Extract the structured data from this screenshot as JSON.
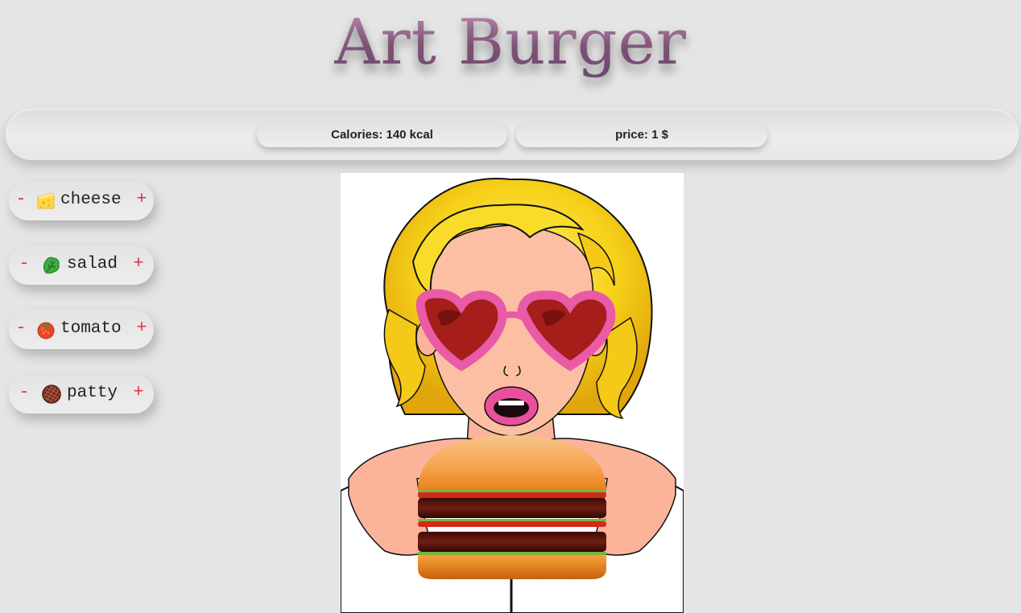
{
  "app": {
    "title": "Art Burger"
  },
  "stats": {
    "calories": "Calories: 140 kcal",
    "price": "price: 1 $"
  },
  "ingredients": [
    {
      "label": "cheese",
      "icon": "cheese-icon",
      "minus": "-",
      "plus": "+"
    },
    {
      "label": "salad",
      "icon": "lettuce-icon",
      "minus": "-",
      "plus": "+"
    },
    {
      "label": "tomato",
      "icon": "tomato-icon",
      "minus": "-",
      "plus": "+"
    },
    {
      "label": "patty",
      "icon": "patty-icon",
      "minus": "-",
      "plus": "+"
    }
  ],
  "colors": {
    "background": "#e5e5e5",
    "button_sign": "#e0344a",
    "title_gradient_top": "#c08fb2",
    "title_gradient_bottom": "#6f4f78"
  },
  "burger": {
    "layers": [
      "bun-top",
      "tomato",
      "patty",
      "salad",
      "tomato",
      "patty",
      "salad",
      "bun-bottom"
    ]
  }
}
